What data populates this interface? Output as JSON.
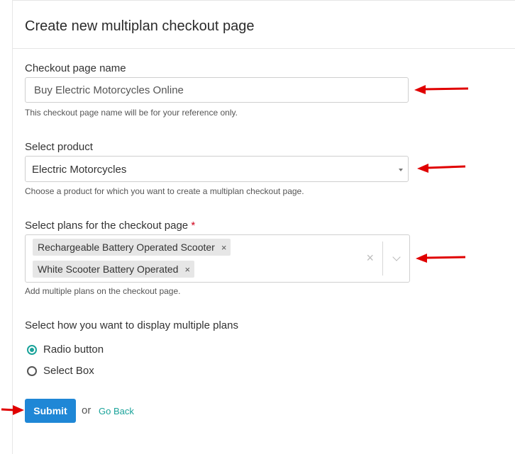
{
  "title": "Create new multiplan checkout page",
  "page_name": {
    "label": "Checkout page name",
    "value": "Buy Electric Motorcycles Online",
    "help": "This checkout page name will be for your reference only."
  },
  "product": {
    "label": "Select product",
    "value": "Electric Motorcycles",
    "help": "Choose a product for which you want to create a multiplan checkout page."
  },
  "plans": {
    "label": "Select plans for the checkout page",
    "required_mark": "*",
    "tags": [
      {
        "label": "Rechargeable Battery Operated Scooter",
        "remove": "×"
      },
      {
        "label": "White Scooter Battery Operated",
        "remove": "×"
      }
    ],
    "clear": "×",
    "help": "Add multiple plans on the checkout page."
  },
  "display": {
    "label": "Select how you want to display multiple plans",
    "options": [
      {
        "label": "Radio button",
        "selected": true
      },
      {
        "label": "Select Box",
        "selected": false
      }
    ]
  },
  "actions": {
    "submit": "Submit",
    "or": "or",
    "go_back": "Go Back"
  },
  "colors": {
    "accent": "#1aa39a",
    "primary_button": "#1f87d6",
    "annotation_arrow": "#e00000"
  }
}
